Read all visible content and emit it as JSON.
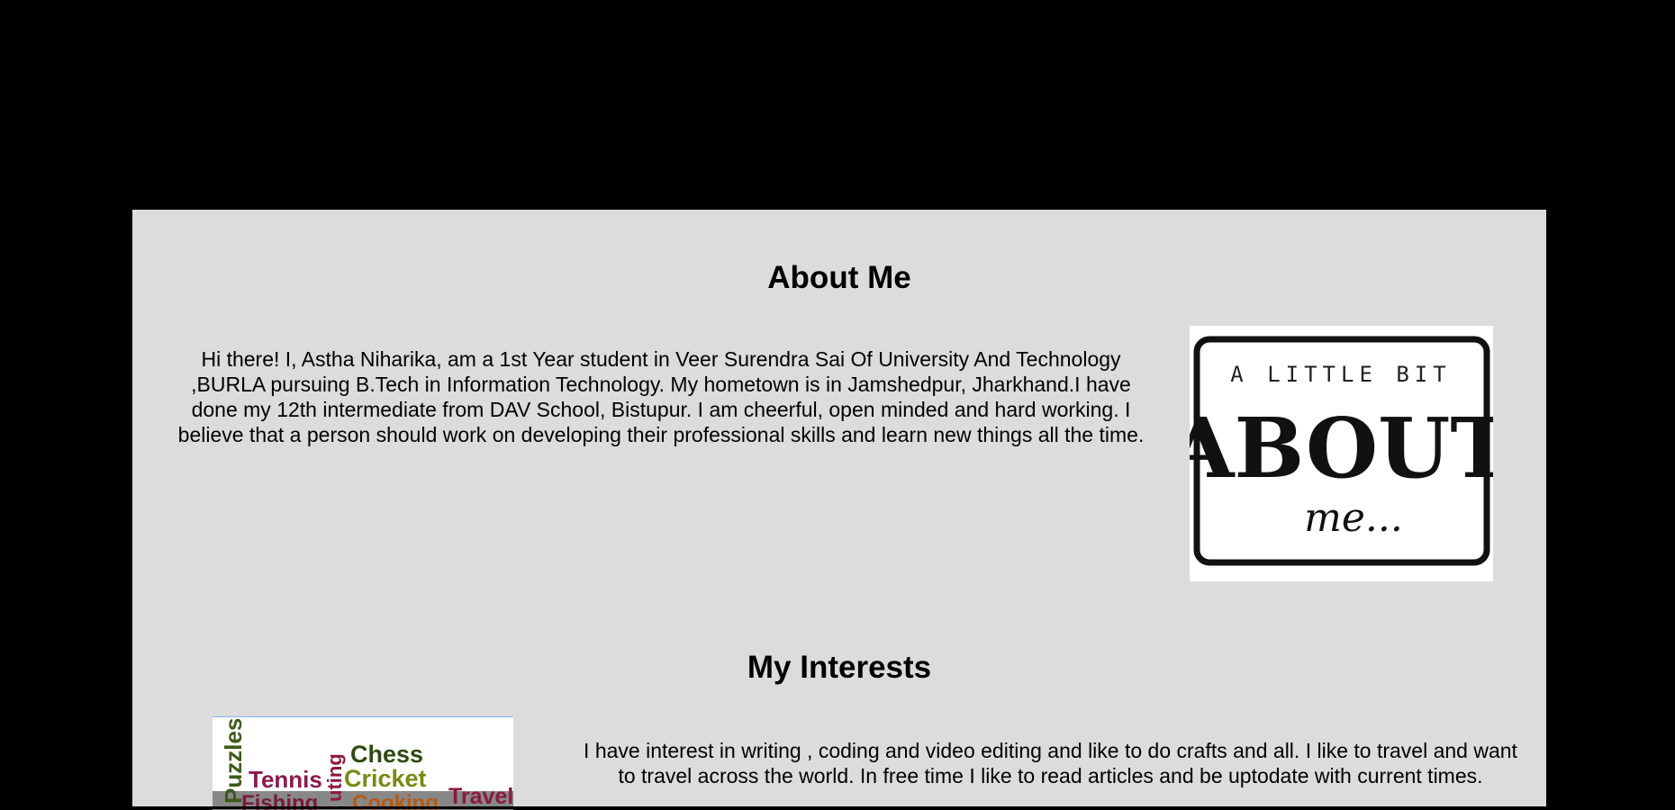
{
  "about": {
    "heading": "About Me",
    "text": "Hi there! I, Astha Niharika, am a 1st Year student in Veer Surendra Sai Of University And Technology ,BURLA pursuing B.Tech in Information Technology. My hometown is in Jamshedpur, Jharkhand.I have done my 12th intermediate from DAV School, Bistupur. I am cheerful, open minded and hard working. I believe that a person should work on developing their professional skills and learn new things all the time.",
    "image": {
      "line1": "A LITTLE BIT",
      "line2": "ABOUT",
      "line3": "me..."
    }
  },
  "interests": {
    "heading": "My Interests",
    "text": "I have interest in writing , coding and video editing and like to do crafts and all. I like to travel and want to travel across the world. In free time I like to read articles and be uptodate with current times.",
    "image": {
      "words": [
        "Puzzles",
        "Chess",
        "Tennis",
        "Cricket",
        "Fishing",
        "Cooking",
        "Travel",
        "uting"
      ]
    }
  },
  "colors": {
    "page_background": "#000000",
    "panel_background": "#dcdcdc"
  }
}
